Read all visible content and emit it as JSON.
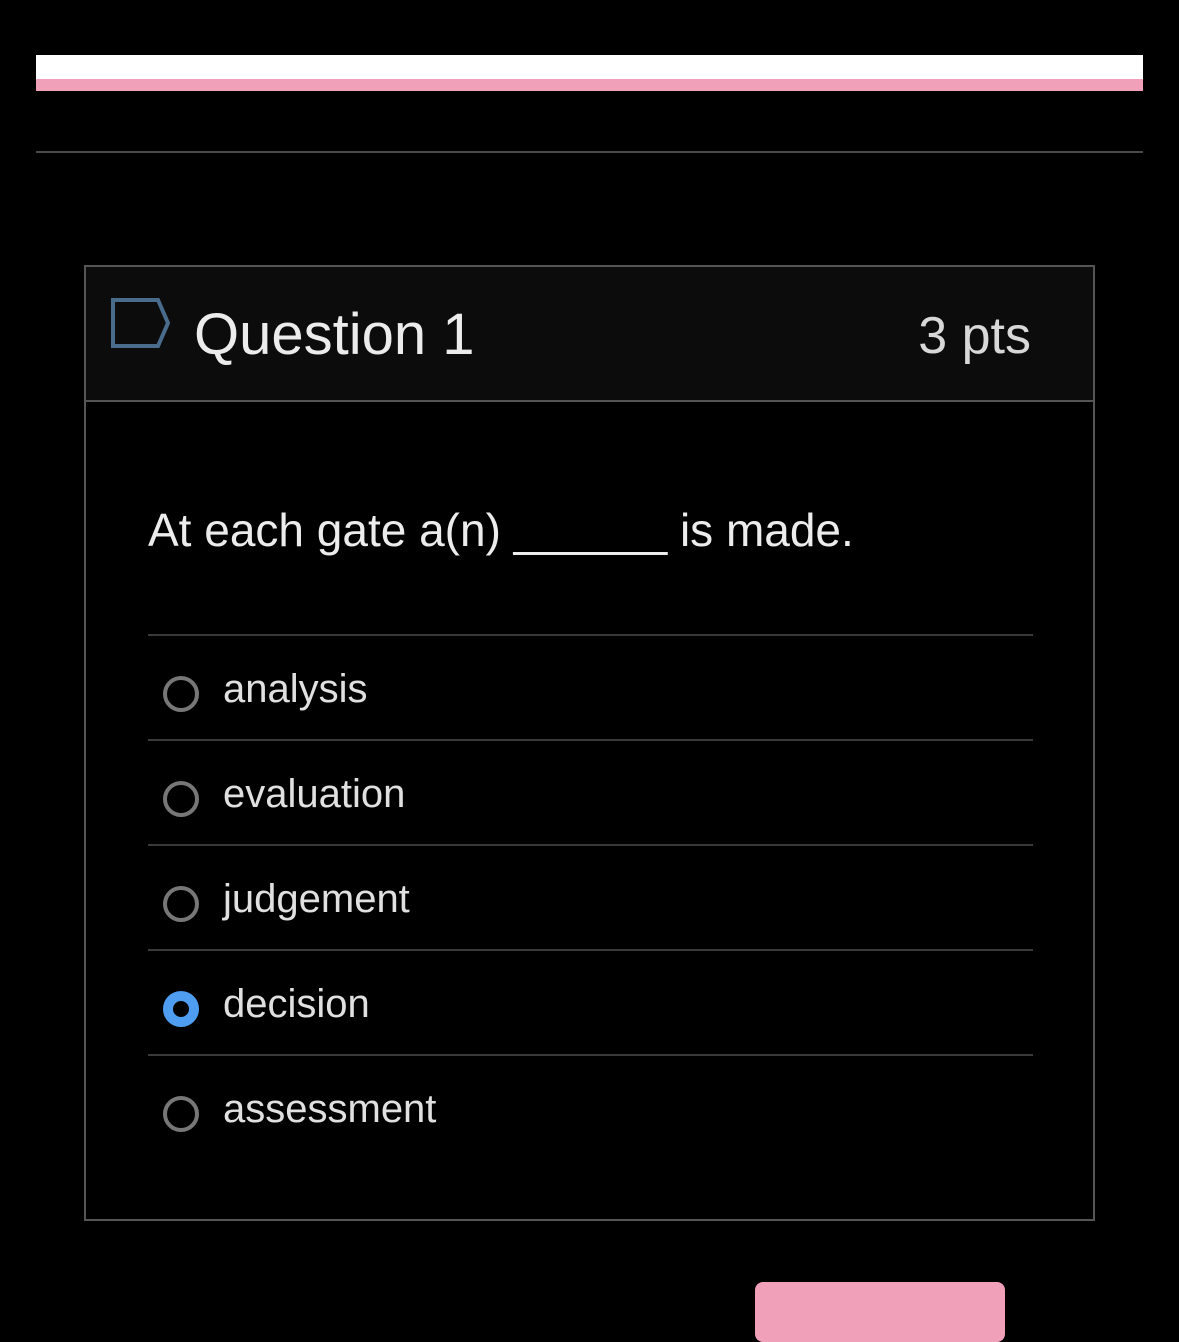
{
  "question": {
    "title": "Question 1",
    "points": "3 pts",
    "text": "At each gate a(n) ______ is made."
  },
  "answers": [
    {
      "label": "analysis",
      "selected": false
    },
    {
      "label": "evaluation",
      "selected": false
    },
    {
      "label": "judgement",
      "selected": false
    },
    {
      "label": "decision",
      "selected": true
    },
    {
      "label": "assessment",
      "selected": false
    }
  ],
  "colors": {
    "accent_pink": "#f0a0b8",
    "radio_selected": "#4f9df0",
    "flag_icon": "#4a6c8c"
  },
  "icons": {
    "flag": "flag-question-icon"
  }
}
